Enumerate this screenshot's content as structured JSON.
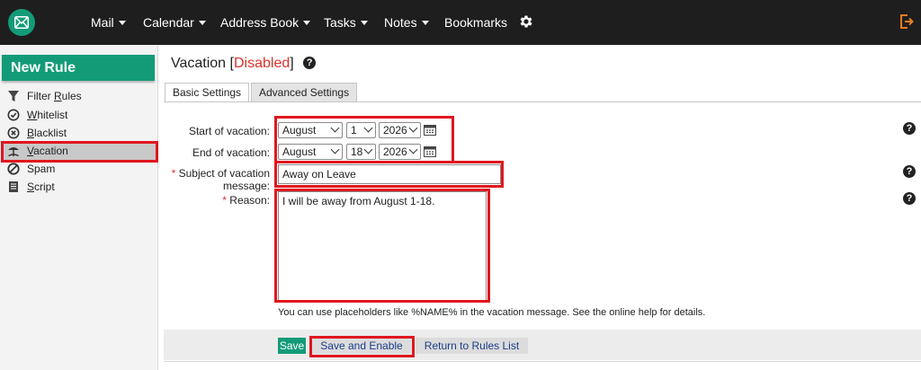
{
  "nav": {
    "items": [
      {
        "label": "Mail"
      },
      {
        "label": "Calendar"
      },
      {
        "label": "Address Book"
      },
      {
        "label": "Tasks"
      },
      {
        "label": "Notes"
      },
      {
        "label": "Bookmarks"
      }
    ]
  },
  "sidebar": {
    "new_rule_label": "New Rule",
    "items": [
      {
        "label_pre": "Filter ",
        "label_ul": "R",
        "label_post": "ules",
        "icon": "funnel-icon"
      },
      {
        "label_pre": "",
        "label_ul": "W",
        "label_post": "hitelist",
        "icon": "check-circle-icon"
      },
      {
        "label_pre": "",
        "label_ul": "B",
        "label_post": "lacklist",
        "icon": "x-circle-icon"
      },
      {
        "label_pre": "",
        "label_ul": "V",
        "label_post": "acation",
        "icon": "vacation-icon",
        "active": true
      },
      {
        "label_pre": "Spam",
        "label_ul": "",
        "label_post": "",
        "icon": "no-entry-icon"
      },
      {
        "label_pre": "",
        "label_ul": "S",
        "label_post": "cript",
        "icon": "script-icon"
      }
    ]
  },
  "page": {
    "title": "Vacation",
    "status_open": "[",
    "status": "Disabled",
    "status_close": "]"
  },
  "tabs": {
    "basic": "Basic Settings",
    "advanced": "Advanced Settings"
  },
  "form": {
    "start_label": "Start of vacation:",
    "start_month": "August",
    "start_day": "1",
    "start_year": "2026",
    "end_label": "End of vacation:",
    "end_month": "August",
    "end_day": "18",
    "end_year": "2026",
    "subject_label_1": "Subject of vacation",
    "subject_label_2": "message:",
    "subject_value": "Away on Leave",
    "reason_label": "Reason:",
    "reason_value": "I will be away from August 1-18.",
    "required_mark": "*",
    "hint": "You can use placeholders like %NAME% in the vacation message. See the online help for details."
  },
  "buttons": {
    "save": "Save",
    "save_enable": "Save and Enable",
    "return": "Return to Rules List"
  },
  "help_glyph": "?",
  "colors": {
    "accent": "#139b78",
    "topbar": "#1e1e1e",
    "disabled": "#d9322a",
    "highlight": "#e0161f",
    "logout": "#e87d1e"
  }
}
